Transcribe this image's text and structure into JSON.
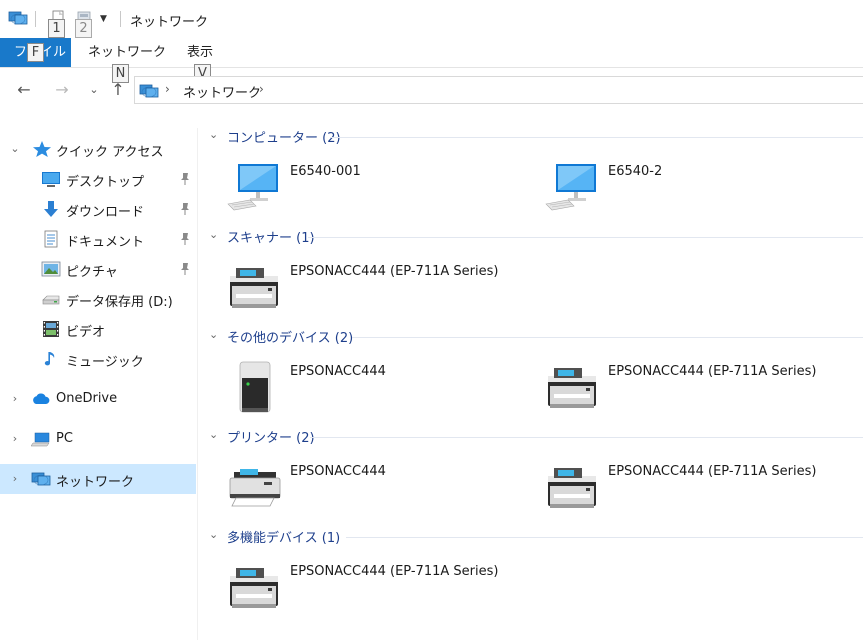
{
  "window": {
    "title": "ネットワーク",
    "keytips": {
      "qa1": "1",
      "qa2": "2",
      "file": "F",
      "network": "N",
      "view": "V"
    }
  },
  "ribbon": {
    "file_label": "ファイル",
    "tabs": [
      "ネットワーク",
      "表示"
    ]
  },
  "address": {
    "breadcrumb": "ネットワーク"
  },
  "navpane": {
    "quick_access": {
      "label": "クイック アクセス",
      "items": [
        {
          "label": "デスクトップ",
          "icon": "desktop-icon",
          "pinned": true
        },
        {
          "label": "ダウンロード",
          "icon": "download-icon",
          "pinned": true
        },
        {
          "label": "ドキュメント",
          "icon": "document-icon",
          "pinned": true
        },
        {
          "label": "ピクチャ",
          "icon": "pictures-icon",
          "pinned": true
        },
        {
          "label": "データ保存用 (D:)",
          "icon": "drive-icon",
          "pinned": false
        },
        {
          "label": "ビデオ",
          "icon": "video-icon",
          "pinned": false
        },
        {
          "label": "ミュージック",
          "icon": "music-icon",
          "pinned": false
        }
      ]
    },
    "onedrive": "OneDrive",
    "pc": "PC",
    "network": "ネットワーク"
  },
  "groups": [
    {
      "header": "コンピューター (2)",
      "items": [
        {
          "name": "E6540-001",
          "icon": "computer-icon"
        },
        {
          "name": "E6540-2",
          "icon": "computer-icon"
        }
      ]
    },
    {
      "header": "スキャナー (1)",
      "items": [
        {
          "name": "EPSONACC444 (EP-711A Series)",
          "icon": "mfp-printer-icon"
        }
      ]
    },
    {
      "header": "その他のデバイス (2)",
      "items": [
        {
          "name": "EPSONACC444",
          "icon": "server-device-icon"
        },
        {
          "name": "EPSONACC444 (EP-711A Series)",
          "icon": "mfp-printer-icon"
        }
      ]
    },
    {
      "header": "プリンター (2)",
      "items": [
        {
          "name": "EPSONACC444",
          "icon": "printer-icon"
        },
        {
          "name": "EPSONACC444 (EP-711A Series)",
          "icon": "mfp-printer-icon"
        }
      ]
    },
    {
      "header": "多機能デバイス (1)",
      "items": [
        {
          "name": "EPSONACC444 (EP-711A Series)",
          "icon": "mfp-printer-icon"
        }
      ]
    }
  ],
  "colors": {
    "accent": "#1979ca",
    "selection": "#cce8ff",
    "group_header": "#1e3f8c"
  }
}
